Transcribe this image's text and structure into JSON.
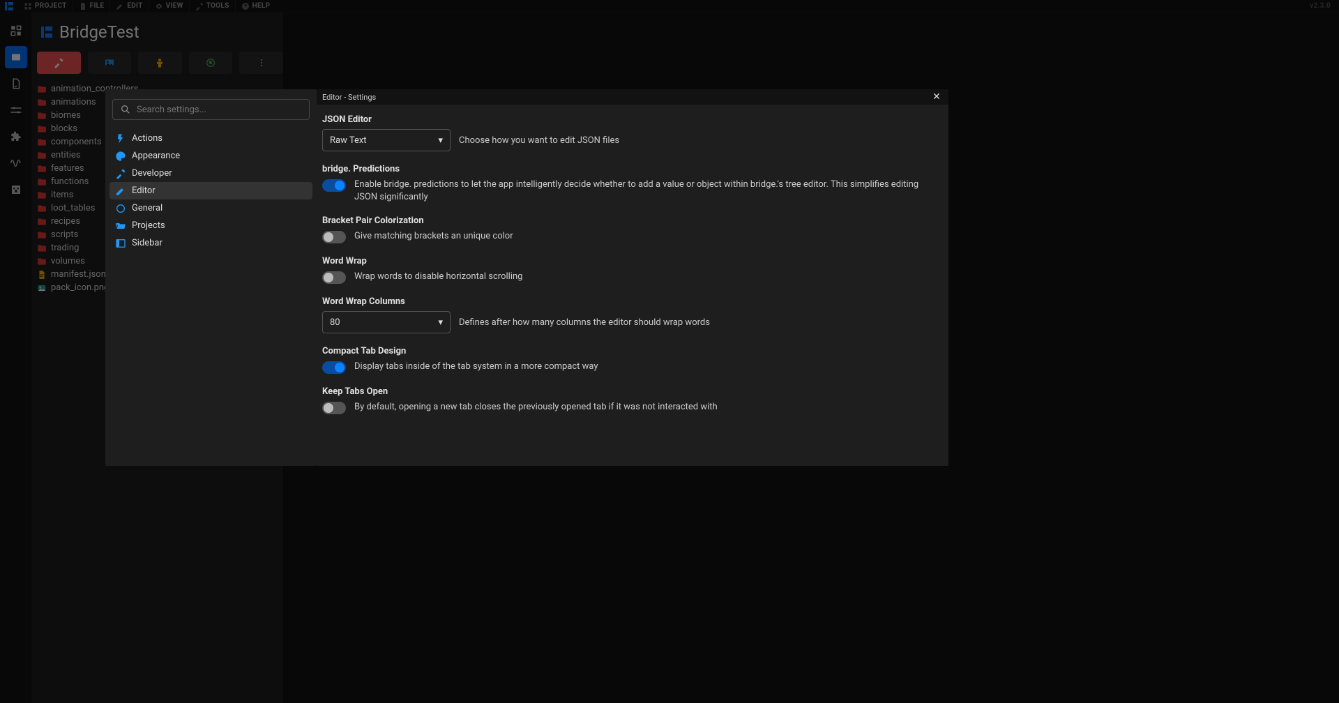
{
  "version": "v2.3.0",
  "menubar": {
    "project": "PROJECT",
    "file": "FILE",
    "edit": "EDIT",
    "view": "VIEW",
    "tools": "TOOLS",
    "help": "HELP"
  },
  "project_title": "BridgeTest",
  "folders": [
    {
      "name": "animation_controllers",
      "type": "folder"
    },
    {
      "name": "animations",
      "type": "folder"
    },
    {
      "name": "biomes",
      "type": "folder"
    },
    {
      "name": "blocks",
      "type": "folder"
    },
    {
      "name": "components",
      "type": "folder"
    },
    {
      "name": "entities",
      "type": "folder"
    },
    {
      "name": "features",
      "type": "folder"
    },
    {
      "name": "functions",
      "type": "folder"
    },
    {
      "name": "items",
      "type": "folder"
    },
    {
      "name": "loot_tables",
      "type": "folder"
    },
    {
      "name": "recipes",
      "type": "folder"
    },
    {
      "name": "scripts",
      "type": "folder"
    },
    {
      "name": "trading",
      "type": "folder"
    },
    {
      "name": "volumes",
      "type": "folder"
    },
    {
      "name": "manifest.json",
      "type": "file-json"
    },
    {
      "name": "pack_icon.png",
      "type": "file-image"
    }
  ],
  "settings": {
    "search_placeholder": "Search settings...",
    "nav": {
      "actions": "Actions",
      "appearance": "Appearance",
      "developer": "Developer",
      "editor": "Editor",
      "general": "General",
      "projects": "Projects",
      "sidebar": "Sidebar"
    },
    "panel_title": "Editor - Settings",
    "json_editor": {
      "title": "JSON Editor",
      "value": "Raw Text",
      "desc": "Choose how you want to edit JSON files"
    },
    "predictions": {
      "title": "bridge. Predictions",
      "on": true,
      "desc": "Enable bridge. predictions to let the app intelligently decide whether to add a value or object within bridge.'s tree editor. This simplifies editing JSON significantly"
    },
    "bracket": {
      "title": "Bracket Pair Colorization",
      "on": false,
      "desc": "Give matching brackets an unique color"
    },
    "wordwrap": {
      "title": "Word Wrap",
      "on": false,
      "desc": "Wrap words to disable horizontal scrolling"
    },
    "wrapcols": {
      "title": "Word Wrap Columns",
      "value": "80",
      "desc": "Defines after how many columns the editor should wrap words"
    },
    "compact": {
      "title": "Compact Tab Design",
      "on": true,
      "desc": "Display tabs inside of the tab system in a more compact way"
    },
    "keeptabs": {
      "title": "Keep Tabs Open",
      "on": false,
      "desc": "By default, opening a new tab closes the previously opened tab if it was not interacted with"
    }
  }
}
